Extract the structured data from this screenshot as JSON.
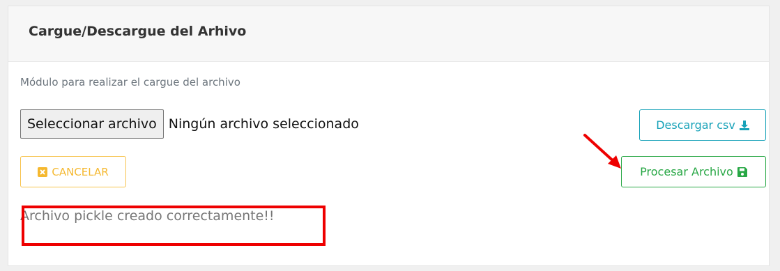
{
  "panel": {
    "title": "Cargue/Descargue del Arhivo",
    "subtitle": "Módulo para realizar el cargue del archivo"
  },
  "file_input": {
    "button_label": "Seleccionar archivo",
    "status": "Ningún archivo seleccionado"
  },
  "buttons": {
    "download_label": "Descargar csv",
    "download_icon": "download-icon",
    "cancel_label": "CANCELAR",
    "cancel_icon": "close-square-icon",
    "process_label": "Procesar Archivo",
    "process_icon": "save-icon"
  },
  "result": {
    "message": "Archivo pickle creado correctamente!!"
  },
  "annotations": {
    "arrow_icon": "arrow-icon",
    "highlight_color": "#ee0000"
  },
  "colors": {
    "info": "#17a2b8",
    "warning": "#f7c34d",
    "success": "#28a745",
    "annotation_red": "#ee0000"
  }
}
